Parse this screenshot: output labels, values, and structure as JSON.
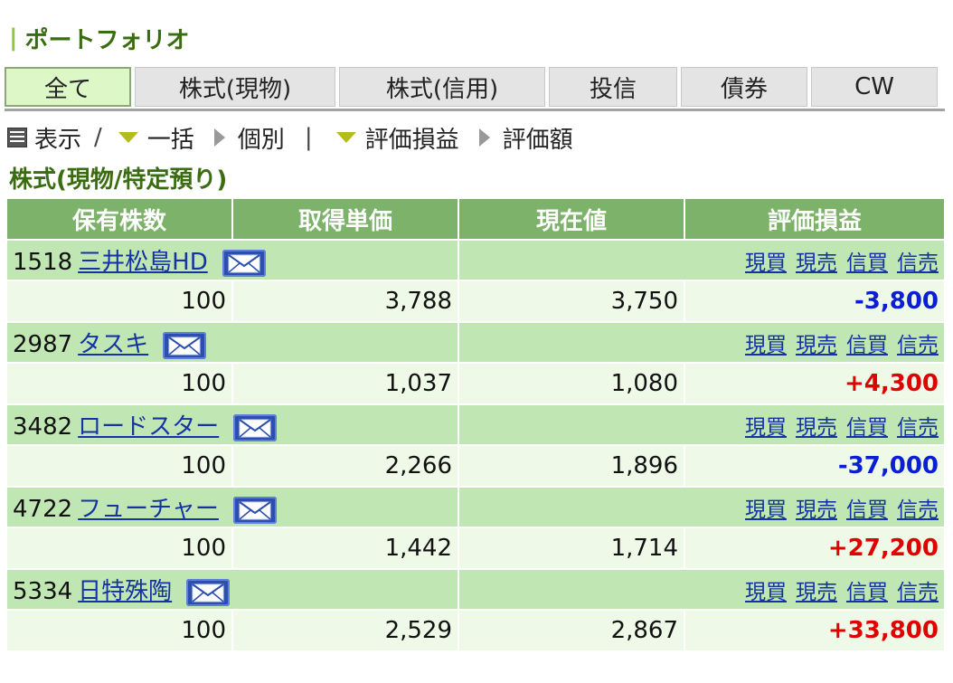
{
  "page": {
    "title": "ポートフォリオ"
  },
  "tabs": [
    {
      "label": "全て",
      "active": true
    },
    {
      "label": "株式(現物)",
      "active": false
    },
    {
      "label": "株式(信用)",
      "active": false
    },
    {
      "label": "投信",
      "active": false
    },
    {
      "label": "債券",
      "active": false
    },
    {
      "label": "CW",
      "active": false
    }
  ],
  "controls": {
    "display_label": "表示",
    "separator": "/",
    "bulk_label": "一括",
    "individual_label": "個別",
    "pl_label": "評価損益",
    "value_label": "評価額"
  },
  "section": {
    "title": "株式(現物/特定預り)"
  },
  "table": {
    "headers": [
      "保有株数",
      "取得単価",
      "現在値",
      "評価損益"
    ],
    "trade_links": [
      "現買",
      "現売",
      "信買",
      "信売"
    ],
    "rows": [
      {
        "code": "1518",
        "name": "三井松島HD",
        "shares": "100",
        "cost": "3,788",
        "price": "3,750",
        "pl": "-3,800",
        "pl_sign": "neg"
      },
      {
        "code": "2987",
        "name": "タスキ",
        "shares": "100",
        "cost": "1,037",
        "price": "1,080",
        "pl": "+4,300",
        "pl_sign": "pos"
      },
      {
        "code": "3482",
        "name": "ロードスター",
        "shares": "100",
        "cost": "2,266",
        "price": "1,896",
        "pl": "-37,000",
        "pl_sign": "neg"
      },
      {
        "code": "4722",
        "name": "フューチャー",
        "shares": "100",
        "cost": "1,442",
        "price": "1,714",
        "pl": "+27,200",
        "pl_sign": "pos"
      },
      {
        "code": "5334",
        "name": "日特殊陶",
        "shares": "100",
        "cost": "2,529",
        "price": "2,867",
        "pl": "+33,800",
        "pl_sign": "pos"
      }
    ]
  },
  "colors": {
    "title_green": "#3a6d10",
    "header_green": "#7cb26a",
    "name_row_green": "#bfe6b3",
    "value_row_green": "#eef9e8",
    "negative_blue": "#0a1fd4",
    "positive_red": "#e00000",
    "link_blue": "#1533a3"
  }
}
